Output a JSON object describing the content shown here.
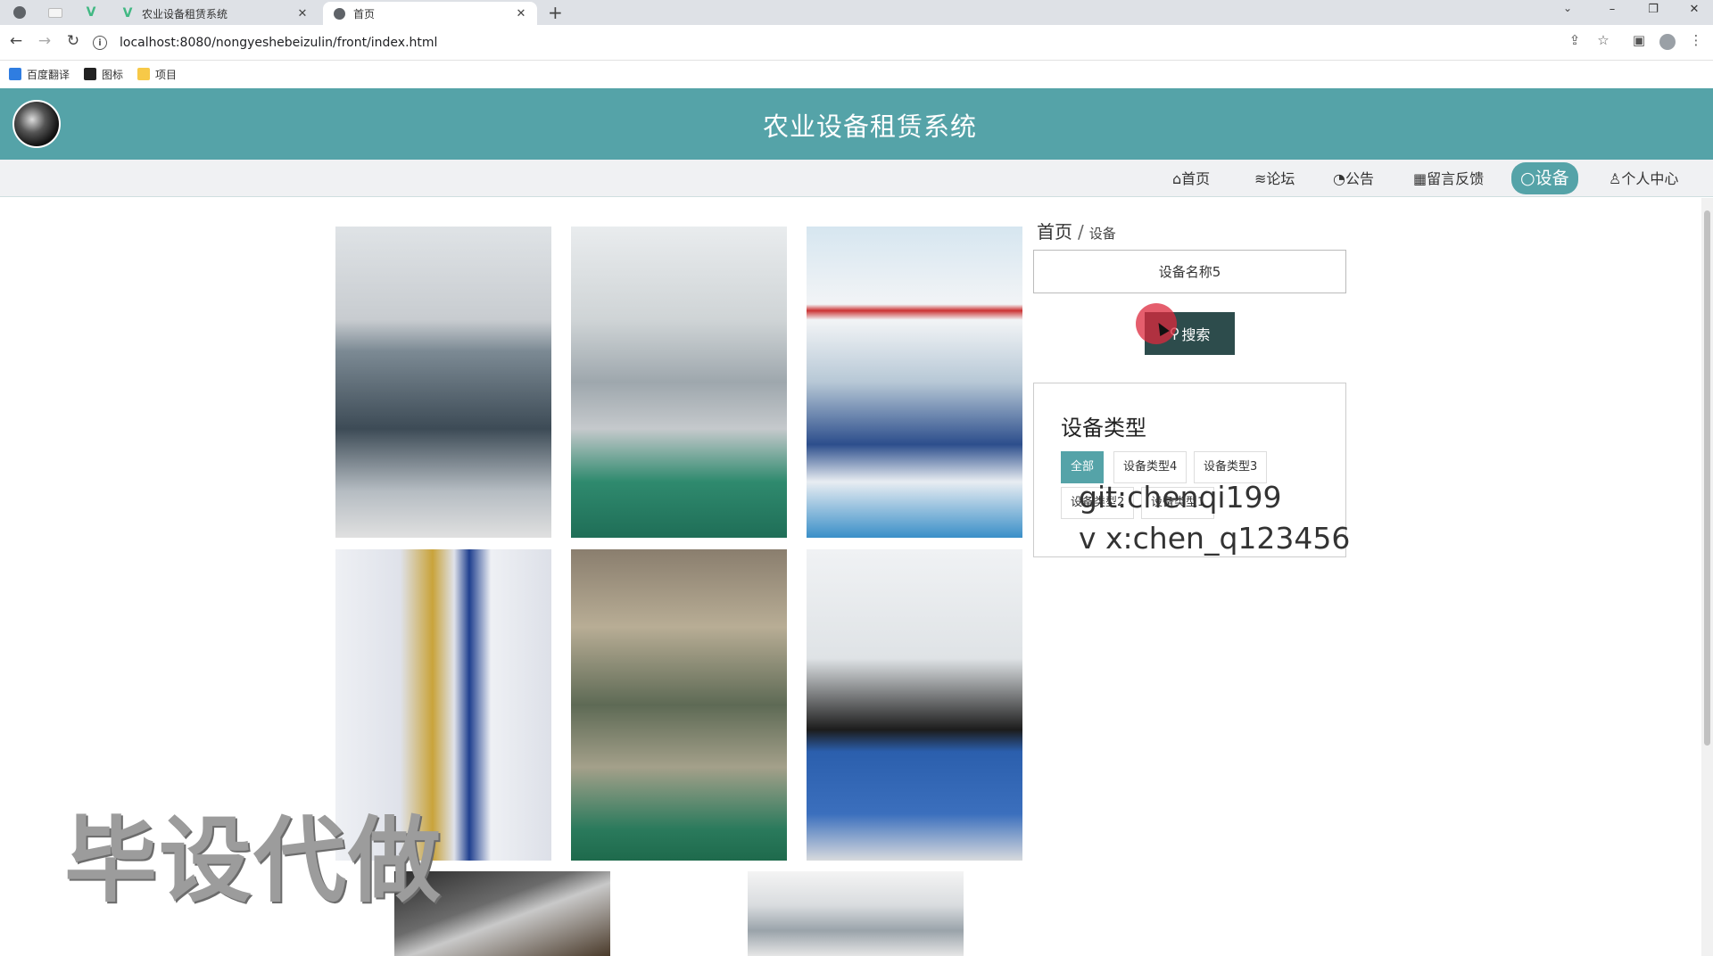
{
  "browser": {
    "tabs": [
      {
        "title": "农业设备租赁系统",
        "active": false
      },
      {
        "title": "首页",
        "active": true
      }
    ],
    "url": "localhost:8080/nongyeshebeizulin/front/index.html",
    "bookmarks": [
      "百度翻译",
      "图标",
      "项目"
    ]
  },
  "site": {
    "title": "农业设备租赁系统",
    "nav": [
      "首页",
      "论坛",
      "公告",
      "留言反馈",
      "设备",
      "个人中心"
    ],
    "nav_icons": [
      "home-icon",
      "graduation-cap-icon",
      "dashboard-icon",
      "message-board-icon",
      "circle-icon",
      "user-icon"
    ],
    "active_nav": "设备",
    "accent_color": "#55a3a8"
  },
  "breadcrumb": {
    "home": "首页",
    "separator": "/",
    "current": "设备"
  },
  "search": {
    "value": "设备名称5",
    "button_label": "搜索"
  },
  "types": {
    "title": "设备类型",
    "tags": [
      "全部",
      "设备类型4",
      "设备类型3",
      "设备类型2",
      "设备类型1"
    ],
    "active": "全部"
  },
  "overlay": {
    "git": "git:chenqi199",
    "vx": "v x:chen_q123456",
    "big": "毕设代做"
  }
}
